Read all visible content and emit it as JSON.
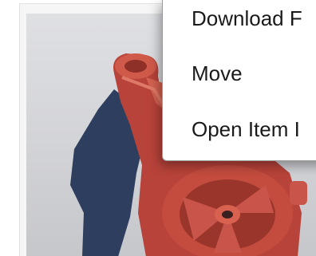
{
  "context_menu": {
    "items": [
      {
        "label": "Download F"
      },
      {
        "label": "Move"
      },
      {
        "label": "Open Item I"
      }
    ]
  },
  "thumbnail": {
    "subject": "red 3D printed mechanical part",
    "colors": {
      "part": "#c0473a",
      "part_highlight": "#d8624f",
      "shadow": "#2e3e5e",
      "background": "#d4d5d9"
    }
  }
}
